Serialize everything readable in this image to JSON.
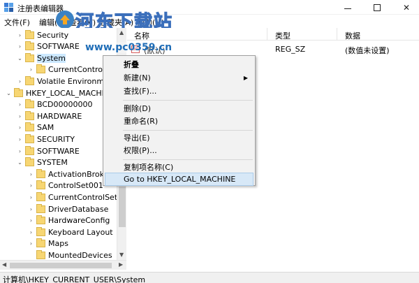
{
  "window": {
    "title": "注册表编辑器"
  },
  "watermark": {
    "title": "河东下载站",
    "url": "www.pc0359.cn"
  },
  "menubar": {
    "items": [
      "文件(F)",
      "编辑(E)",
      "查看(V)",
      "收藏夹(A)",
      "帮助(H)"
    ]
  },
  "tree": {
    "rows": [
      {
        "label": "Security",
        "expander": ">"
      },
      {
        "label": "SOFTWARE",
        "expander": ">"
      },
      {
        "label": "System",
        "expander": "v",
        "selected": true
      },
      {
        "label": "CurrentControlS",
        "expander": ">"
      },
      {
        "label": "Volatile Environme",
        "expander": ">"
      },
      {
        "label": "HKEY_LOCAL_MACHIN",
        "expander": "v"
      },
      {
        "label": "BCD00000000",
        "expander": ">"
      },
      {
        "label": "HARDWARE",
        "expander": ">"
      },
      {
        "label": "SAM",
        "expander": ">"
      },
      {
        "label": "SECURITY",
        "expander": ">"
      },
      {
        "label": "SOFTWARE",
        "expander": ">"
      },
      {
        "label": "SYSTEM",
        "expander": "v"
      },
      {
        "label": "ActivationBroke",
        "expander": ">"
      },
      {
        "label": "ControlSet001",
        "expander": ">"
      },
      {
        "label": "CurrentControlSet",
        "expander": ">"
      },
      {
        "label": "DriverDatabase",
        "expander": ">"
      },
      {
        "label": "HardwareConfig",
        "expander": ">"
      },
      {
        "label": "Keyboard Layout",
        "expander": ">"
      },
      {
        "label": "Maps",
        "expander": ">"
      },
      {
        "label": "MountedDevices",
        "expander": ""
      }
    ]
  },
  "list": {
    "columns": [
      "名称",
      "类型",
      "数据"
    ],
    "rows": [
      {
        "name": "(默认)",
        "type": "REG_SZ",
        "data": "(数值未设置)"
      }
    ]
  },
  "context_menu": {
    "items": [
      {
        "label": "折叠",
        "bold": true
      },
      {
        "label": "新建(N)",
        "submenu": true
      },
      {
        "label": "查找(F)..."
      },
      {
        "label": "删除(D)"
      },
      {
        "label": "重命名(R)"
      },
      {
        "label": "导出(E)"
      },
      {
        "label": "权限(P)..."
      },
      {
        "label": "复制项名称(C)"
      },
      {
        "label": "Go to HKEY_LOCAL_MACHINE",
        "highlighted": true
      }
    ]
  },
  "statusbar": {
    "path": "计算机\\HKEY_CURRENT_USER\\System"
  }
}
